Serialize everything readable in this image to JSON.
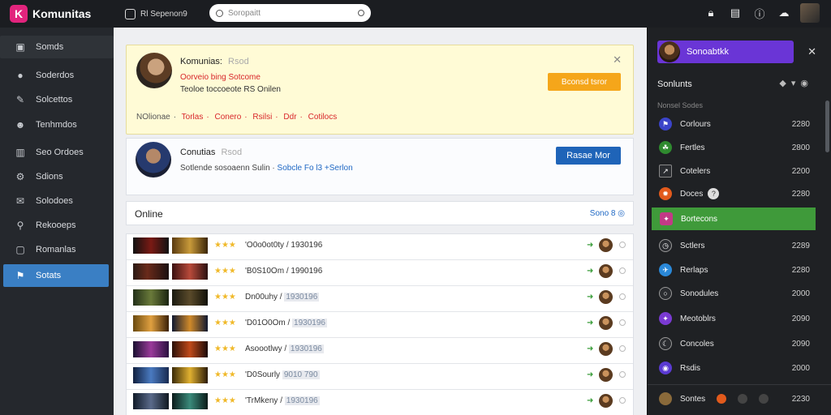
{
  "app": {
    "name": "Komunitas",
    "logo_letter": "K",
    "brand_color": "#e2247d"
  },
  "topbar": {
    "crumb": "Rl Sepenon9",
    "search_placeholder": "Soropaitt",
    "icons": [
      "lock-icon",
      "book-icon",
      "info-icon",
      "cloud-icon",
      "user-avatar"
    ]
  },
  "sidebar": {
    "items": [
      {
        "label": "Somds",
        "icon": "dashboard-icon"
      },
      {
        "label": "Soderdos",
        "icon": "circle-icon"
      },
      {
        "label": "Solcettos",
        "icon": "pen-icon"
      },
      {
        "label": "Tenhmdos",
        "icon": "people-icon"
      },
      {
        "label": "Seo Ordoes",
        "icon": "chart-icon"
      },
      {
        "label": "Sdions",
        "icon": "gear-icon"
      },
      {
        "label": "Solodoes",
        "icon": "mail-icon"
      },
      {
        "label": "Rekooeps",
        "icon": "search-icon"
      },
      {
        "label": "Romanlas",
        "icon": "lock-icon"
      },
      {
        "label": "Sotats",
        "icon": "tag-icon"
      }
    ],
    "active_index": 9
  },
  "notice": {
    "name": "Komunias:",
    "tag": "Rsod",
    "red_line": "Oorveio bing Sotcome",
    "line2": "Teoloe toccoeote RS Onilen",
    "button": "Bconsd tsror",
    "links": [
      "NOlionae",
      "Torlas",
      "Conero",
      "Rsilsi",
      "Ddr",
      "Cotilocs"
    ]
  },
  "profile": {
    "name": "Conutias",
    "tag": "Rsod",
    "line": "Sotlende sosoaenn Sulin",
    "link": "Sobcle Fo l3 +Serlon",
    "button": "Rasae Mor"
  },
  "online": {
    "title": "Online",
    "link": "Sono 8"
  },
  "rows": [
    {
      "stars": "★★★",
      "text": "'O0o0ot0ty / 1930196",
      "tag": ""
    },
    {
      "stars": "★★★",
      "text": "'B0S10Om / 1990196",
      "tag": ""
    },
    {
      "stars": "★★★",
      "text": "Dn00uhy /",
      "tag": "1930196"
    },
    {
      "stars": "★★★",
      "text": "'D01O0Om /",
      "tag": "1930196"
    },
    {
      "stars": "★★★",
      "text": "Asoootlwy /",
      "tag": "1930196"
    },
    {
      "stars": "★★★",
      "text": "'D0Sourly",
      "tag": "9010 790"
    },
    {
      "stars": "★★★",
      "text": "'TrMkeny /",
      "tag": "1930196"
    }
  ],
  "right": {
    "user": "Sonoabtkk",
    "title": "Sonlunts",
    "subtitle": "Nonsel Sodes",
    "items": [
      {
        "label": "Corlours",
        "num": "2280",
        "color": "#3b44c9",
        "icon": "flag-icon"
      },
      {
        "label": "Fertles",
        "num": "2800",
        "color": "#2f8a2f",
        "icon": "leaf-icon"
      },
      {
        "label": "Cotelers",
        "num": "2200",
        "color": "#2a2c30",
        "icon": "square-icon"
      },
      {
        "label": "Doces",
        "num": "2280",
        "color": "#e25a1c",
        "icon": "fire-icon",
        "badge": "?"
      },
      {
        "label": "Bortecons",
        "num": "",
        "color": "#c23a86",
        "icon": "game-icon",
        "highlight": true
      },
      {
        "label": "Sctlers",
        "num": "2289",
        "color": "#2a2c30",
        "icon": "clock-icon"
      },
      {
        "label": "Rerlaps",
        "num": "2280",
        "color": "#2a88d8",
        "icon": "twitter-icon"
      },
      {
        "label": "Sonodules",
        "num": "2000",
        "color": "#2a2c30",
        "icon": "circle-icon"
      },
      {
        "label": "Meotoblrs",
        "num": "2090",
        "color": "#7a3ad2",
        "icon": "puzzle-icon"
      },
      {
        "label": "Concoles",
        "num": "2090",
        "color": "#2a2c30",
        "icon": "moon-icon"
      },
      {
        "label": "Rsdis",
        "num": "2000",
        "color": "#5a3ad2",
        "icon": "planet-icon"
      }
    ],
    "footer": {
      "label": "Sontes",
      "num": "2230"
    }
  }
}
